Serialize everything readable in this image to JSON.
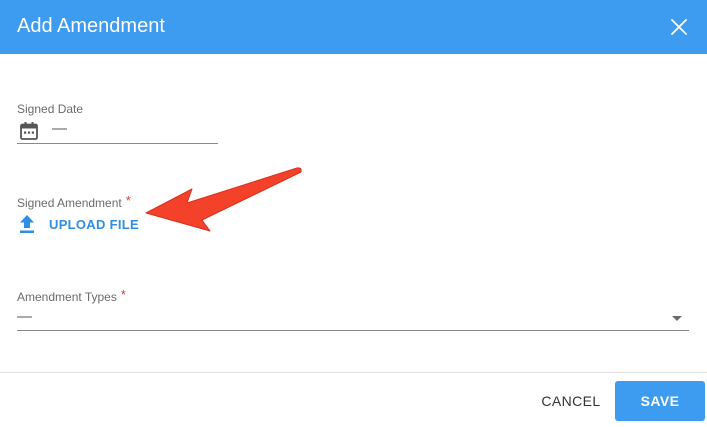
{
  "dialog": {
    "title": "Add Amendment",
    "header_color": "#3d9bf0"
  },
  "fields": {
    "signed_date": {
      "label": "Signed Date",
      "value": "—",
      "icon": "calendar-icon"
    },
    "signed_amendment": {
      "label": "Signed Amendment",
      "required_mark": "*",
      "upload_label": "UPLOAD FILE",
      "icon": "upload-icon"
    },
    "amendment_types": {
      "label": "Amendment Types",
      "required_mark": "*",
      "value": "—",
      "icon": "chevron-down-icon"
    }
  },
  "footer": {
    "cancel_label": "CANCEL",
    "save_label": "SAVE"
  },
  "annotation": {
    "arrow_color": "#f4412a",
    "icon": "red-arrow-annotation"
  },
  "colors": {
    "accent": "#3d9bf0",
    "link": "#2f8ee6",
    "required": "#e53935"
  }
}
